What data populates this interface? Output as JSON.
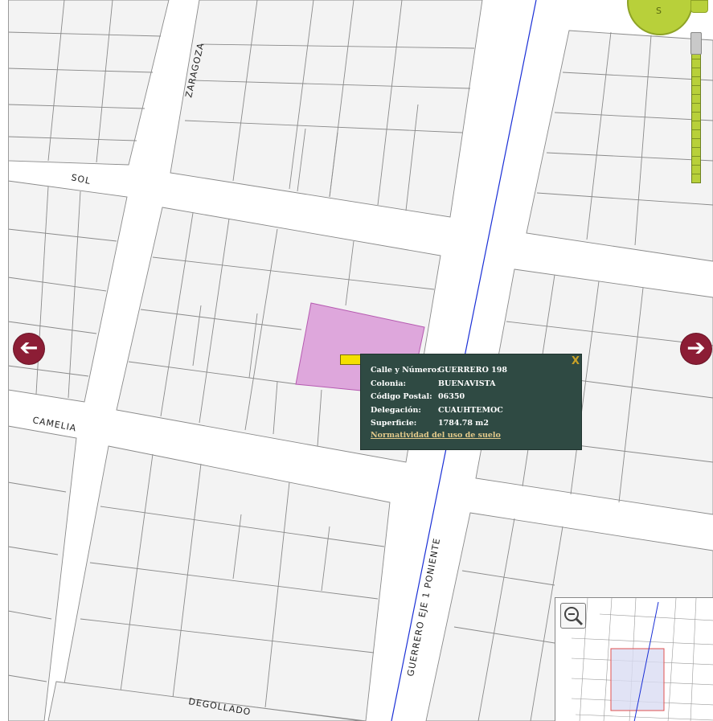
{
  "streets": {
    "zaragoza": "ZARAGOZA",
    "sol": "SOL",
    "camelia": "CAMELIA",
    "degollado": "DEGOLLADO",
    "guerrero": "GUERRERO EJE 1 PONIENTE"
  },
  "compass": {
    "label": "S"
  },
  "nav": {
    "left_icon": "arrow-left-icon",
    "right_icon": "arrow-right-icon",
    "left_glyph": "➔",
    "right_glyph": "➔"
  },
  "popup": {
    "close_label": "X",
    "rows": [
      {
        "label": "Calle y Número:",
        "value": "GUERRERO 198"
      },
      {
        "label": "Colonia:",
        "value": "BUENAVISTA"
      },
      {
        "label": "Código Postal:",
        "value": "06350"
      },
      {
        "label": "Delegación:",
        "value": "CUAUHTEMOC"
      },
      {
        "label": "Superficie:",
        "value": "1784.78 m2"
      }
    ],
    "link_label": "Normatividad del uso de suelo"
  },
  "colors": {
    "selected_lot": "#dea7dc",
    "popup_bg": "#2f4a43",
    "nav_arrow": "#8c1d35",
    "control_green": "#b8d03a",
    "boundary_line": "#1a2fd6",
    "overview_extent": "#e05050"
  },
  "overview": {
    "zoom_icon": "zoom-out-icon"
  }
}
